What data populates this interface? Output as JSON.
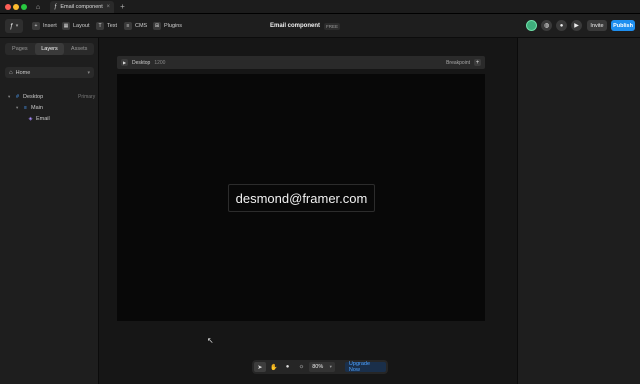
{
  "window": {
    "tab_title": "Email component",
    "tab_close": "×",
    "new_tab": "+"
  },
  "toolbar": {
    "logo_icon": "framer-logo",
    "insert": "Insert",
    "layout": "Layout",
    "text": "Text",
    "cms": "CMS",
    "plugins": "Plugins",
    "doc_title": "Email component",
    "doc_badge": "FREE",
    "invite": "Invite",
    "publish": "Publish",
    "publish_color": "#1e8ff0"
  },
  "left_panel": {
    "tabs": [
      "Pages",
      "Layers",
      "Assets"
    ],
    "active_tab": "Layers",
    "page_select": "Home",
    "layers": [
      {
        "label": "Desktop",
        "meta": "Primary",
        "icon": "frame-icon"
      },
      {
        "label": "Main",
        "meta": "",
        "icon": "stack-icon"
      },
      {
        "label": "Email",
        "meta": "",
        "icon": "component-icon"
      }
    ]
  },
  "canvas": {
    "frame_name": "Desktop",
    "frame_width": "1200",
    "breakpoint": "Breakpoint",
    "email_text": "desmond@framer.com",
    "frame_bg": "#080808"
  },
  "bottom_toolbar": {
    "zoom": "80%",
    "upgrade": "Upgrade Now",
    "upgrade_color": "#4ea2ff"
  }
}
